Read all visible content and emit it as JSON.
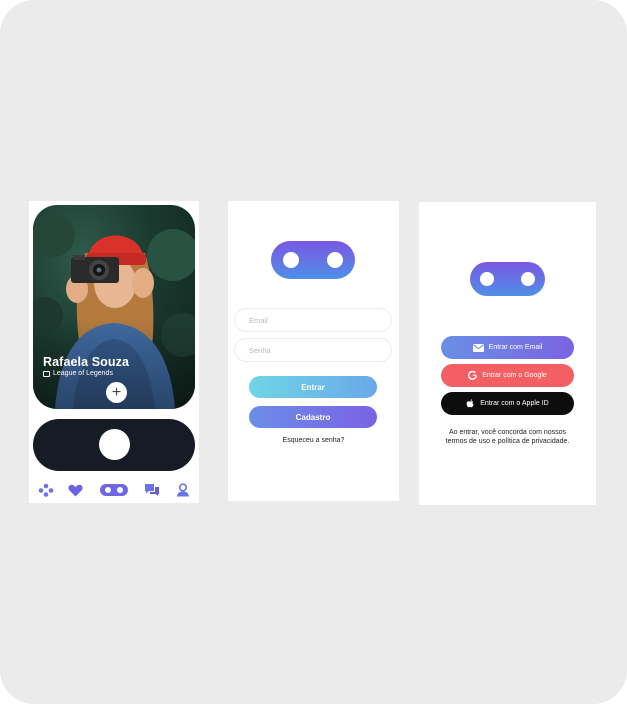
{
  "profile_screen": {
    "name": "Rafaela Souza",
    "game": "League of Legends",
    "add_symbol": "+",
    "nav": [
      "gamepad-icon",
      "heart-icon",
      "app-logo-icon",
      "chat-icon",
      "user-icon"
    ]
  },
  "login_screen": {
    "email_placeholder": "Email",
    "password_placeholder": "Senha",
    "enter_label": "Entrar",
    "register_label": "Cadastro",
    "forgot_label": "Esqueceu a senha?"
  },
  "social_screen": {
    "email_button": "Entrar com Email",
    "google_button": "Entrar com o Google",
    "apple_button": "Entrar com o Apple ID",
    "terms_line1": "Ao entrar, você concorda com nossos",
    "terms_line2": "termos de uso e política de privacidade."
  },
  "colors": {
    "board": "#ebebeb",
    "brand_purple": "#7b57e3",
    "brand_blue": "#4f8fe6",
    "dark_pill": "#161b26",
    "google_red": "#f35f62",
    "apple_black": "#0d0d0d",
    "entrar_cyan": "#6fd5e6"
  }
}
